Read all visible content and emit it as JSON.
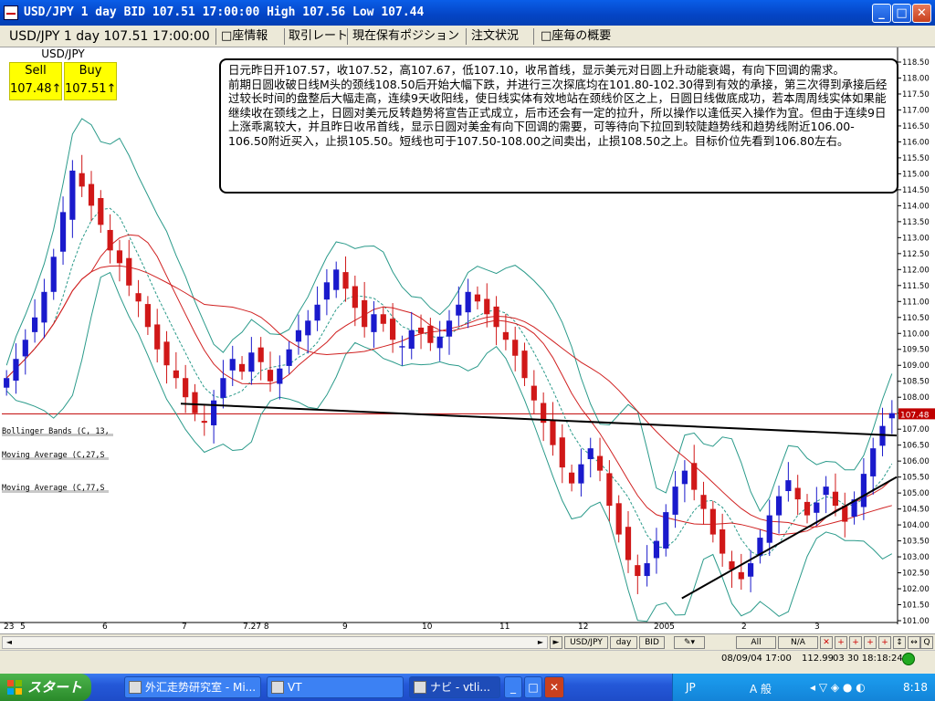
{
  "window": {
    "title": "USD/JPY 1 day BID 107.51 17:00:00 High 107.56 Low 107.44",
    "minimize": "_",
    "maximize": "□",
    "close": "✕"
  },
  "toolbar": {
    "symbol_info": "USD/JPY 1 day 107.51 17:00:00",
    "tabs": [
      "□座情報",
      "取引レート",
      "現在保有ポジション",
      "注文状況",
      "□座毎の概要"
    ]
  },
  "quote": {
    "pair": "USD/JPY",
    "sell_label": "Sell",
    "buy_label": "Buy",
    "sell_value": "107.48",
    "buy_value": "107.51",
    "arrow": "↑"
  },
  "note": {
    "para1": "日元昨日开107.57，收107.52，高107.67，低107.10，收吊首线，显示美元对日圆上升动能衰竭，有向下回调的需求。",
    "para2": "前期日圆收破日线M头的颈线108.50后开始大幅下跌，并进行三次探底均在101.80-102.30得到有效的承接，第三次得到承接后经过较长时间的盘整后大幅走高，连续9天收阳线，使日线实体有效地站在颈线价区之上，日圆日线做底成功，若本周周线实体如果能继续收在颈线之上，日圆对美元反转趋势将宣告正式成立，后市还会有一定的拉升，所以操作以逢低买入操作为宜。但由于连续9日上涨乖离较大，并且昨日收吊首线，显示日圆对美金有向下回调的需要，可等待向下拉回到较陡趋势线和趋势线附近106.00-106.50附近买入，止损105.50。短线也可于107.50-108.00之间卖出，止损108.50之上。目标价位先看到106.80左右。"
  },
  "indicators": [
    "Bollinger Bands (C, 13,",
    "Moving Average (C,27,S",
    "Moving Average (C,77,S"
  ],
  "price_axis": {
    "labels": [
      "118.50",
      "118.00",
      "117.50",
      "117.00",
      "116.50",
      "116.00",
      "115.50",
      "115.00",
      "114.50",
      "114.00",
      "113.50",
      "113.00",
      "112.50",
      "112.00",
      "111.50",
      "111.00",
      "110.50",
      "110.00",
      "109.50",
      "109.00",
      "108.50",
      "108.00",
      "107.50",
      "107.00",
      "106.50",
      "106.00",
      "105.50",
      "105.00",
      "104.50",
      "104.00",
      "103.50",
      "103.00",
      "102.50",
      "102.00",
      "101.50",
      "101.00"
    ],
    "current_tag": "107.48",
    "color_current": "#c00000"
  },
  "time_axis": [
    "23",
    "5",
    "6",
    "7",
    "7.27 8",
    "9",
    "10",
    "11",
    "12",
    "2005",
    "2",
    "3"
  ],
  "navbar": {
    "left_arrow": "◄",
    "right_arrow": "►",
    "symbol": "USD/JPY",
    "period": "day",
    "side": "BID",
    "all": "All",
    "na": "N/A"
  },
  "status": {
    "datetime": "08/09/04 17:00",
    "price": "112.99",
    "clock": "03 30 18:18:24"
  },
  "taskbar": {
    "start": "スタート",
    "tasks": [
      "外汇走势研究室 - Mi...",
      "VT",
      "ナビ - vtli..."
    ],
    "lang": "JP",
    "ime": "A 般",
    "time": "8:18"
  },
  "chart_data": {
    "type": "candlestick",
    "symbol": "USD/JPY",
    "period": "1 day",
    "ylim": [
      101.0,
      118.5
    ],
    "last_price": 107.48,
    "high": 107.56,
    "low": 107.44,
    "indicators": [
      "Bollinger Bands (C,13)",
      "Moving Average (C,27,S)",
      "Moving Average (C,77,S)"
    ],
    "trendlines": [
      {
        "from": [
          0.2,
          107.8
        ],
        "to": [
          1.0,
          106.8
        ]
      },
      {
        "from": [
          0.76,
          101.7
        ],
        "to": [
          1.0,
          105.5
        ]
      }
    ],
    "candles_close": [
      108.6,
      109.2,
      109.8,
      110.5,
      111.3,
      112.4,
      113.8,
      115.1,
      114.6,
      114.0,
      113.4,
      112.6,
      112.2,
      111.5,
      111.0,
      110.2,
      109.5,
      109.0,
      108.6,
      108.0,
      107.5,
      107.2,
      107.9,
      108.6,
      109.2,
      108.8,
      109.4,
      109.1,
      108.5,
      108.9,
      109.5,
      110.1,
      110.4,
      110.9,
      111.6,
      112.0,
      111.4,
      110.8,
      110.2,
      110.6,
      110.3,
      109.8,
      109.6,
      110.1,
      110.0,
      109.7,
      109.9,
      110.4,
      110.9,
      111.3,
      111.0,
      110.6,
      110.2,
      109.8,
      109.3,
      108.6,
      107.9,
      107.2,
      106.5,
      105.8,
      105.3,
      105.9,
      106.4,
      105.7,
      104.6,
      103.7,
      102.9,
      102.4,
      102.8,
      103.5,
      104.4,
      105.2,
      105.7,
      105.1,
      104.5,
      103.7,
      103.1,
      102.6,
      102.3,
      102.8,
      103.6,
      104.3,
      104.9,
      105.4,
      104.8,
      104.3,
      104.7,
      105.2,
      104.6,
      104.1,
      104.8,
      105.6,
      106.4,
      107.1,
      107.5
    ]
  }
}
